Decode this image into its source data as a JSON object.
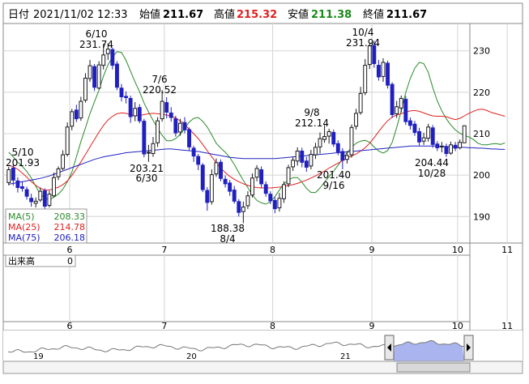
{
  "header": {
    "date_label": "日付",
    "date_value": "2021/11/02 12:33",
    "open_label": "始値",
    "open_value": "211.67",
    "high_label": "高値",
    "high_value": "215.32",
    "low_label": "安値",
    "low_value": "211.38",
    "close_label": "終値",
    "close_value": "211.67"
  },
  "colors": {
    "up": "#1a1a1a",
    "down": "#2020c0",
    "ma5": "#2a8a2a",
    "ma25": "#e02020",
    "ma75": "#2020c0",
    "high_value": "#e02020",
    "low_value": "#1a8a1a",
    "overview_fill": "#aab4ee"
  },
  "legend": [
    {
      "label": "MA(5)",
      "value": "208.33",
      "color": "#2a8a2a"
    },
    {
      "label": "MA(25)",
      "value": "214.78",
      "color": "#e02020"
    },
    {
      "label": "MA(75)",
      "value": "206.18",
      "color": "#2020c0"
    }
  ],
  "volume": {
    "label": "出来高",
    "value": "0"
  },
  "annotations": [
    {
      "date": "5/10",
      "value": "201.93",
      "anchor": "high"
    },
    {
      "date": "6/10",
      "value": "231.74",
      "anchor": "high"
    },
    {
      "date": "6/30",
      "value": "203.21",
      "anchor": "low"
    },
    {
      "date": "7/6",
      "value": "220.52",
      "anchor": "high"
    },
    {
      "date": "8/4",
      "value": "188.38",
      "anchor": "low"
    },
    {
      "date": "9/8",
      "value": "212.14",
      "anchor": "high"
    },
    {
      "date": "9/16",
      "value": "201.40",
      "anchor": "low"
    },
    {
      "date": "10/4",
      "value": "231.94",
      "anchor": "high"
    },
    {
      "date": "10/28",
      "value": "204.44",
      "anchor": "low"
    }
  ],
  "overview": {
    "labels": [
      "19",
      "20",
      "21"
    ]
  },
  "chart_data": {
    "type": "candlestick",
    "x_ticks": [
      "6",
      "7",
      "8",
      "9",
      "10",
      "11"
    ],
    "y_ticks": [
      190,
      200,
      210,
      220,
      230
    ],
    "ylim": [
      184,
      236
    ],
    "grid": true,
    "legend_placement": "bottom-left",
    "series": [
      {
        "name": "MA(5)",
        "values": [
          205.5,
          204.4,
          203.1,
          202.1,
          200.9,
          199.3,
          197.3,
          195.4,
          194.5,
          194.0,
          194.7,
          195.4,
          196.6,
          198.4,
          200.7,
          204.4,
          208.1,
          211.4,
          214.8,
          217.7,
          220.5,
          223.9,
          226.6,
          228.5,
          229.8,
          229.6,
          227.7,
          225.1,
          222.5,
          220.1,
          217.4,
          215.2,
          213.2,
          211.3,
          209.6,
          208.3,
          208.3,
          208.8,
          209.8,
          211.3,
          212.8,
          213.7,
          213.9,
          213.0,
          211.6,
          209.7,
          207.7,
          206.5,
          205.5,
          204.3,
          202.6,
          200.6,
          198.7,
          197.0,
          195.2,
          193.9,
          193.3,
          193.0,
          193.6,
          194.8,
          196.4,
          197.9,
          198.8,
          199.4,
          199.4,
          198.3,
          196.8,
          195.8,
          195.8,
          196.9,
          198.3,
          199.6,
          200.9,
          202.4,
          203.9,
          205.4,
          206.7,
          207.7,
          208.2,
          208.4,
          207.9,
          206.8,
          205.8,
          205.3,
          205.9,
          207.9,
          211.5,
          215.5,
          219.9,
          223.3,
          225.8,
          227.2,
          226.9,
          224.8,
          221.1,
          217.9,
          215.5,
          213.6,
          212.1,
          210.9,
          210.1,
          209.6,
          209.2,
          208.6,
          207.7,
          207.3,
          207.3,
          207.5,
          207.6,
          207.4,
          207.8
        ]
      },
      {
        "name": "MA(25)",
        "values": [
          202.4,
          202.0,
          201.4,
          200.5,
          199.5,
          198.4,
          197.5,
          196.8,
          196.4,
          196.4,
          196.7,
          197.1,
          197.7,
          198.6,
          199.9,
          201.5,
          203.2,
          205.0,
          206.8,
          208.6,
          210.4,
          212.0,
          213.3,
          214.2,
          214.8,
          215.0,
          214.9,
          214.6,
          214.4,
          214.4,
          214.6,
          214.8,
          214.9,
          214.8,
          214.7,
          214.5,
          214.2,
          213.8,
          213.1,
          212.2,
          211.1,
          210.0,
          208.8,
          207.4,
          205.9,
          204.4,
          203.0,
          201.7,
          200.6,
          199.7,
          199.0,
          198.4,
          197.9,
          197.5,
          197.2,
          197.0,
          196.9,
          196.9,
          196.9,
          197.0,
          197.1,
          197.3,
          197.5,
          197.7,
          198.0,
          198.4,
          198.8,
          199.3,
          199.8,
          200.4,
          201.0,
          201.7,
          202.3,
          202.9,
          203.5,
          204.1,
          204.6,
          205.1,
          205.8,
          206.6,
          207.7,
          209.0,
          210.5,
          211.9,
          213.1,
          214.0,
          214.5,
          214.8,
          215.2,
          215.5,
          215.6,
          215.4,
          215.0,
          214.6,
          214.3,
          214.2,
          214.2,
          214.1,
          213.7,
          213.4,
          213.7,
          214.3,
          214.9,
          215.4,
          215.8,
          215.9,
          215.6,
          215.1,
          214.8,
          214.5,
          214.2
        ]
      },
      {
        "name": "MA(75)",
        "values": [
          197.8,
          198.0,
          198.2,
          198.4,
          198.6,
          198.8,
          199.0,
          199.2,
          199.5,
          199.8,
          200.2,
          200.6,
          201.0,
          201.4,
          201.8,
          202.2,
          202.6,
          203.0,
          203.4,
          203.8,
          204.1,
          204.4,
          204.6,
          204.8,
          205.0,
          205.2,
          205.4,
          205.5,
          205.6,
          205.7,
          205.8,
          205.9,
          206.0,
          206.1,
          206.2,
          206.3,
          206.3,
          206.2,
          206.1,
          206.0,
          205.9,
          205.8,
          205.7,
          205.5,
          205.3,
          205.1,
          204.9,
          204.7,
          204.5,
          204.3,
          204.2,
          204.1,
          204.0,
          204.0,
          204.0,
          204.0,
          204.0,
          204.0,
          204.0,
          204.0,
          204.1,
          204.2,
          204.3,
          204.4,
          204.5,
          204.6,
          204.7,
          204.8,
          204.9,
          205.0,
          205.1,
          205.2,
          205.3,
          205.4,
          205.5,
          205.6,
          205.7,
          205.8,
          205.9,
          206.0,
          206.1,
          206.2,
          206.3,
          206.4,
          206.5,
          206.6,
          206.7,
          206.8,
          206.9,
          207.0,
          207.0,
          207.0,
          207.0,
          207.0,
          207.0,
          207.0,
          206.9,
          206.9,
          206.8,
          206.8,
          206.7,
          206.7,
          206.6,
          206.6,
          206.5,
          206.5,
          206.4,
          206.3,
          206.3,
          206.2,
          206.2
        ]
      }
    ],
    "candles": [
      [
        198.2,
        201.3,
        202.0,
        197.5
      ],
      [
        201.7,
        198.8,
        202.5,
        197.5
      ],
      [
        198.6,
        197.0,
        199.5,
        195.8
      ],
      [
        197.2,
        196.8,
        198.5,
        196.0
      ],
      [
        196.5,
        194.9,
        197.2,
        194.1
      ],
      [
        194.4,
        193.6,
        195.5,
        192.4
      ],
      [
        193.2,
        193.7,
        194.6,
        192.2
      ],
      [
        194.0,
        196.1,
        197.0,
        193.5
      ],
      [
        196.2,
        192.5,
        196.8,
        191.8
      ],
      [
        192.7,
        195.4,
        196.2,
        192.2
      ],
      [
        195.0,
        199.4,
        200.6,
        194.6
      ],
      [
        199.6,
        201.5,
        202.1,
        198.8
      ],
      [
        201.6,
        204.9,
        206.0,
        201.2
      ],
      [
        205.0,
        211.6,
        212.7,
        204.5
      ],
      [
        211.8,
        215.3,
        216.0,
        210.8
      ],
      [
        215.7,
        213.6,
        217.0,
        212.8
      ],
      [
        213.8,
        217.8,
        218.9,
        213.1
      ],
      [
        218.1,
        223.4,
        224.6,
        217.5
      ],
      [
        223.3,
        226.4,
        227.8,
        222.5
      ],
      [
        226.2,
        221.2,
        226.8,
        220.3
      ],
      [
        221.0,
        226.6,
        227.5,
        220.7
      ],
      [
        226.5,
        229.0,
        231.7,
        225.5
      ],
      [
        229.3,
        230.4,
        231.8,
        227.8
      ],
      [
        230.3,
        226.5,
        230.8,
        225.5
      ],
      [
        226.8,
        221.2,
        227.5,
        220.5
      ],
      [
        221.0,
        218.9,
        222.0,
        217.8
      ],
      [
        219.0,
        218.7,
        220.2,
        217.3
      ],
      [
        218.5,
        214.1,
        219.2,
        212.6
      ],
      [
        214.3,
        216.1,
        217.6,
        213.0
      ],
      [
        216.3,
        213.1,
        217.1,
        212.5
      ],
      [
        213.0,
        205.1,
        213.6,
        204.3
      ],
      [
        205.3,
        205.5,
        207.3,
        203.2
      ],
      [
        205.2,
        207.6,
        209.2,
        204.4
      ],
      [
        207.8,
        213.1,
        214.0,
        206.8
      ],
      [
        213.6,
        217.8,
        220.5,
        212.9
      ],
      [
        217.5,
        215.2,
        218.8,
        213.7
      ],
      [
        215.0,
        213.9,
        216.4,
        212.9
      ],
      [
        213.6,
        210.2,
        214.3,
        209.3
      ],
      [
        210.4,
        212.5,
        213.6,
        209.5
      ],
      [
        212.7,
        210.9,
        214.0,
        210.1
      ],
      [
        211.0,
        206.8,
        211.5,
        206.0
      ],
      [
        206.5,
        204.6,
        207.1,
        203.2
      ],
      [
        204.5,
        202.6,
        205.1,
        201.2
      ],
      [
        202.4,
        196.5,
        202.9,
        195.9
      ],
      [
        196.3,
        193.4,
        197.1,
        191.4
      ],
      [
        193.6,
        200.1,
        201.4,
        192.9
      ],
      [
        200.3,
        203.0,
        204.0,
        199.6
      ],
      [
        203.1,
        199.2,
        203.8,
        198.5
      ],
      [
        199.0,
        197.9,
        199.9,
        197.0
      ],
      [
        198.1,
        196.1,
        198.8,
        195.0
      ],
      [
        196.4,
        193.7,
        197.4,
        193.1
      ],
      [
        193.6,
        191.0,
        194.2,
        190.0
      ],
      [
        191.2,
        192.3,
        193.6,
        188.4
      ],
      [
        192.6,
        195.0,
        196.1,
        191.8
      ],
      [
        195.2,
        199.3,
        200.4,
        194.6
      ],
      [
        199.5,
        201.6,
        202.4,
        198.5
      ],
      [
        201.3,
        197.9,
        202.1,
        197.0
      ],
      [
        197.7,
        195.6,
        198.5,
        194.8
      ],
      [
        195.4,
        193.8,
        196.1,
        193.0
      ],
      [
        193.9,
        191.9,
        194.7,
        190.8
      ],
      [
        192.1,
        194.4,
        195.7,
        191.2
      ],
      [
        194.3,
        197.7,
        198.5,
        193.3
      ],
      [
        197.9,
        201.8,
        202.5,
        197.1
      ],
      [
        202.0,
        203.6,
        204.4,
        201.0
      ],
      [
        203.4,
        205.8,
        206.7,
        202.3
      ],
      [
        205.8,
        203.1,
        206.6,
        201.9
      ],
      [
        203.4,
        201.9,
        204.4,
        200.8
      ],
      [
        202.2,
        205.0,
        206.1,
        201.4
      ],
      [
        204.9,
        206.7,
        207.8,
        203.9
      ],
      [
        206.8,
        208.8,
        210.3,
        205.2
      ],
      [
        208.6,
        209.3,
        212.1,
        207.8
      ],
      [
        209.4,
        210.5,
        211.2,
        207.6
      ],
      [
        210.3,
        207.5,
        211.0,
        206.8
      ],
      [
        207.6,
        205.6,
        208.4,
        204.8
      ],
      [
        205.7,
        203.6,
        206.5,
        201.4
      ],
      [
        203.8,
        204.7,
        205.8,
        202.8
      ],
      [
        204.9,
        211.5,
        212.2,
        204.2
      ],
      [
        211.8,
        214.9,
        216.0,
        211.0
      ],
      [
        215.1,
        219.7,
        221.3,
        214.6
      ],
      [
        219.9,
        226.5,
        228.0,
        219.3
      ],
      [
        226.7,
        231.2,
        232.0,
        225.6
      ],
      [
        231.3,
        226.9,
        232.4,
        225.9
      ],
      [
        226.5,
        223.7,
        227.8,
        222.8
      ],
      [
        223.8,
        227.2,
        228.2,
        222.5
      ],
      [
        227.0,
        221.7,
        227.6,
        220.9
      ],
      [
        221.9,
        214.6,
        222.4,
        213.8
      ],
      [
        214.8,
        216.5,
        217.9,
        213.8
      ],
      [
        216.2,
        218.5,
        219.2,
        215.1
      ],
      [
        218.3,
        212.9,
        219.1,
        212.1
      ],
      [
        213.1,
        212.0,
        213.9,
        211.0
      ],
      [
        212.3,
        210.3,
        213.1,
        209.5
      ],
      [
        210.5,
        208.0,
        211.4,
        207.1
      ],
      [
        208.2,
        209.0,
        210.2,
        207.3
      ],
      [
        208.9,
        211.6,
        212.4,
        208.1
      ],
      [
        211.4,
        207.4,
        212.1,
        206.6
      ],
      [
        207.5,
        206.6,
        208.2,
        205.8
      ],
      [
        206.8,
        207.0,
        208.0,
        205.5
      ],
      [
        206.9,
        205.2,
        207.6,
        204.4
      ],
      [
        205.3,
        207.3,
        208.1,
        204.9
      ],
      [
        207.2,
        206.5,
        208.0,
        205.8
      ],
      [
        206.6,
        207.9,
        208.6,
        206.2
      ],
      [
        207.8,
        211.9,
        212.0,
        210.9
      ]
    ]
  }
}
